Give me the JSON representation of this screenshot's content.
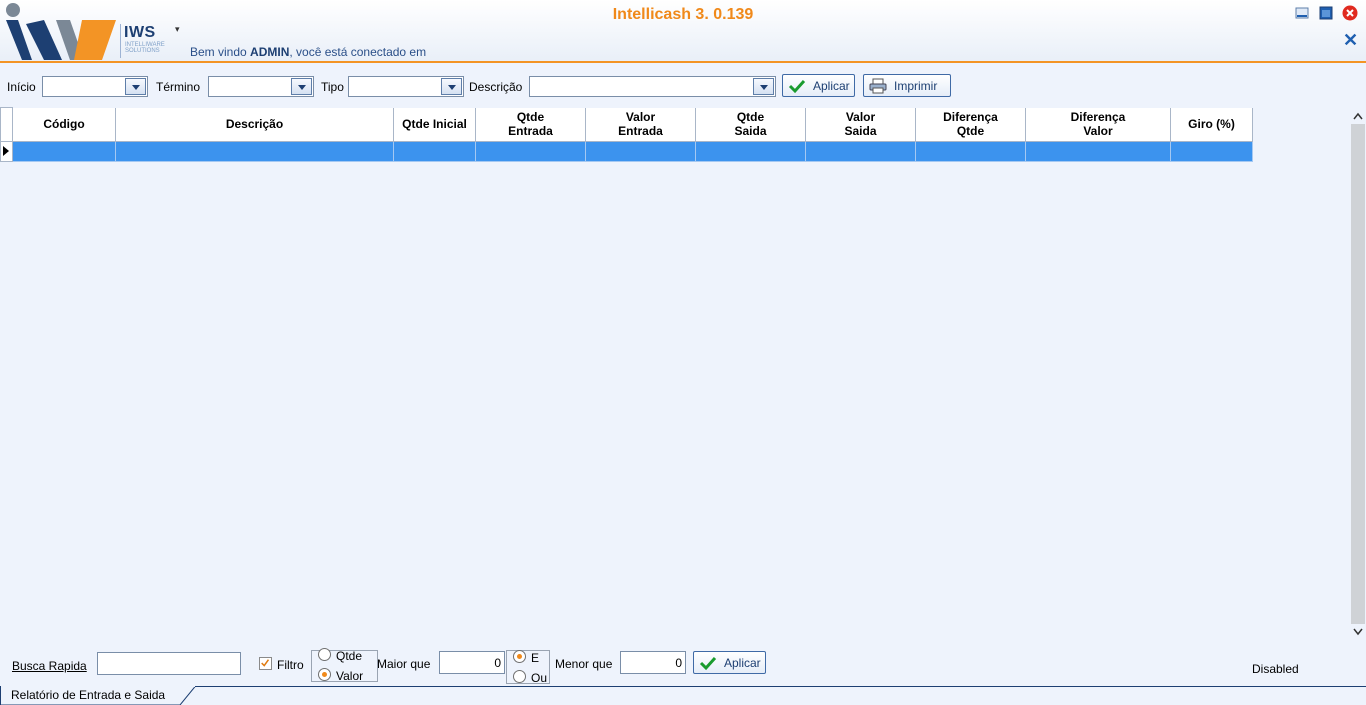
{
  "header": {
    "brand": "IWS",
    "brand_sub": "INTELLIWARE SOLUTIONS",
    "user_menu_icon": "▾",
    "welcome_prefix": "Bem vindo ",
    "welcome_user": "ADMIN",
    "welcome_suffix": ", você está conectado em",
    "app_title": "Intellicash 3. 0.139",
    "close_x": "✕"
  },
  "toolbar": {
    "inicio_label": "Início",
    "termino_label": "Término",
    "tipo_label": "Tipo",
    "descricao_label": "Descrição",
    "aplicar_label": "Aplicar",
    "imprimir_label": "Imprimir"
  },
  "grid": {
    "columns": [
      "Código",
      "Descrição",
      "Qtde Inicial",
      "Qtde\nEntrada",
      "Valor\nEntrada",
      "Qtde\nSaida",
      "Valor\nSaida",
      "Diferença\nQtde",
      "Diferença\nValor",
      "Giro (%)"
    ]
  },
  "bottom": {
    "busca_label": "Busca Rapida",
    "filtro_label": "Filtro",
    "qtde_label": "Qtde",
    "valor_label": "Valor",
    "maior_label": "Maior que",
    "maior_value": "0",
    "e_label": "E",
    "ou_label": "Ou",
    "menor_label": "Menor que",
    "menor_value": "0",
    "aplicar_label": "Aplicar",
    "status": "Disabled"
  },
  "tabs": {
    "active": "Relatório de Entrada e Saida"
  },
  "colors": {
    "accent_orange": "#f0891a",
    "navy": "#1d3f72",
    "selection_blue": "#3c93ee"
  }
}
